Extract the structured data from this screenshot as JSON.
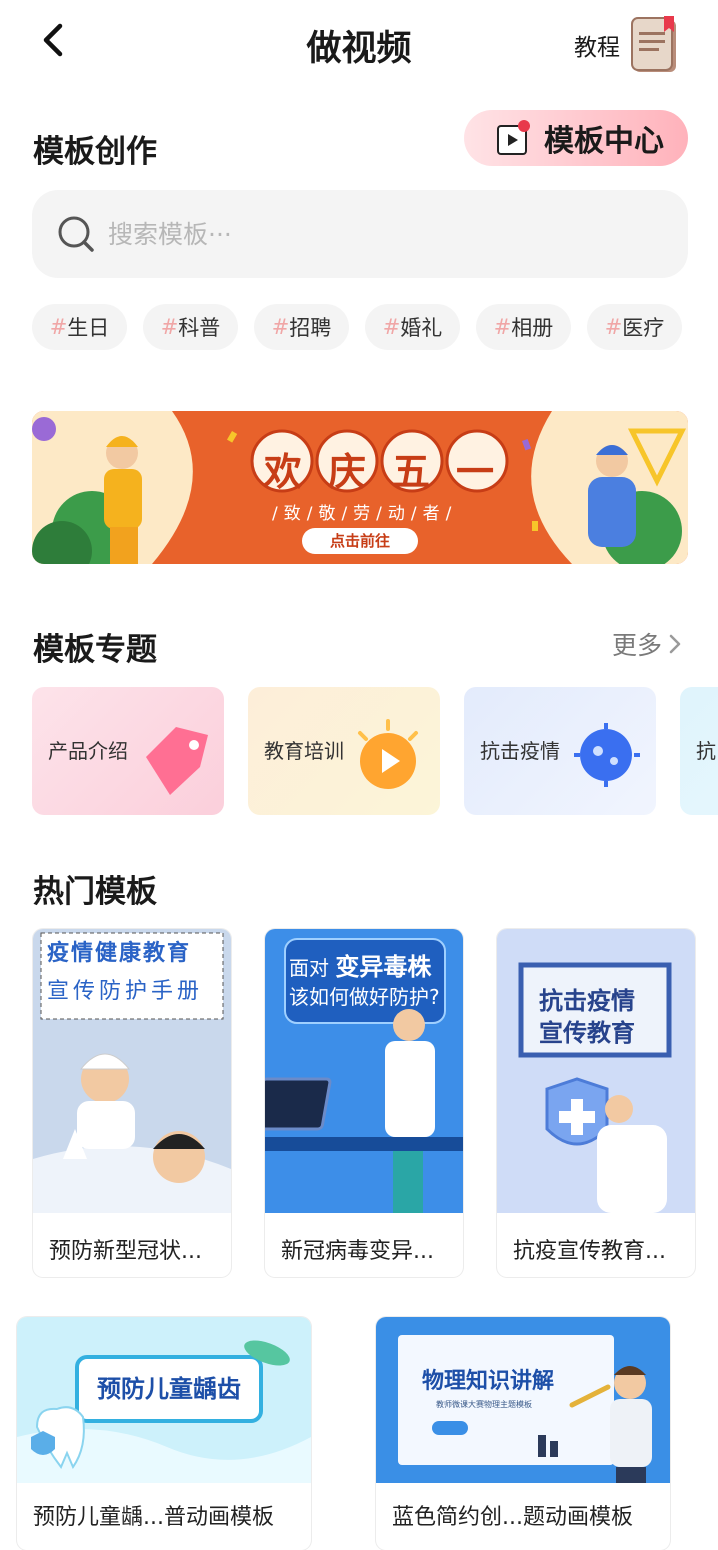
{
  "header": {
    "title": "做视频",
    "tutorial_label": "教程"
  },
  "template_creation": {
    "title": "模板创作",
    "center_button": "模板中心",
    "search_placeholder": "搜索模板···"
  },
  "tags": [
    "生日",
    "科普",
    "招聘",
    "婚礼",
    "相册",
    "医疗"
  ],
  "tag_prefix": "#",
  "banner": {
    "title": "欢庆五一",
    "subtitle": "/致/敬/劳/动/者/",
    "button": "点击前往"
  },
  "topics": {
    "title": "模板专题",
    "more_label": "更多",
    "items": [
      {
        "label": "产品介绍",
        "icon": "price-tag-icon"
      },
      {
        "label": "教育培训",
        "icon": "sun-play-icon"
      },
      {
        "label": "抗击疫情",
        "icon": "virus-icon"
      },
      {
        "label": "抗"
      }
    ]
  },
  "hot": {
    "title": "热门模板",
    "cards": [
      {
        "caption": "预防新型冠状...",
        "thumb_line1": "疫情健康教育",
        "thumb_line2": "宣传防护手册"
      },
      {
        "caption": "新冠病毒变异...",
        "thumb_line1": "面对",
        "thumb_line1b": "变异毒株",
        "thumb_line2": "该如何做好防护?"
      },
      {
        "caption": "抗疫宣传教育...",
        "thumb_line1": "抗击疫情",
        "thumb_line2": "宣传教育"
      },
      {
        "caption": "预防儿童龋...普动画模板",
        "thumb_line1": "预防儿童龋齿"
      },
      {
        "caption": "蓝色简约创...题动画模板",
        "thumb_line1": "物理知识讲解",
        "thumb_line2": "教师微课大赛物理主题模板"
      }
    ]
  },
  "colors": {
    "accent_pink": "#ffb2bb",
    "banner_orange": "#e8622b",
    "blue": "#3d8ee8"
  }
}
